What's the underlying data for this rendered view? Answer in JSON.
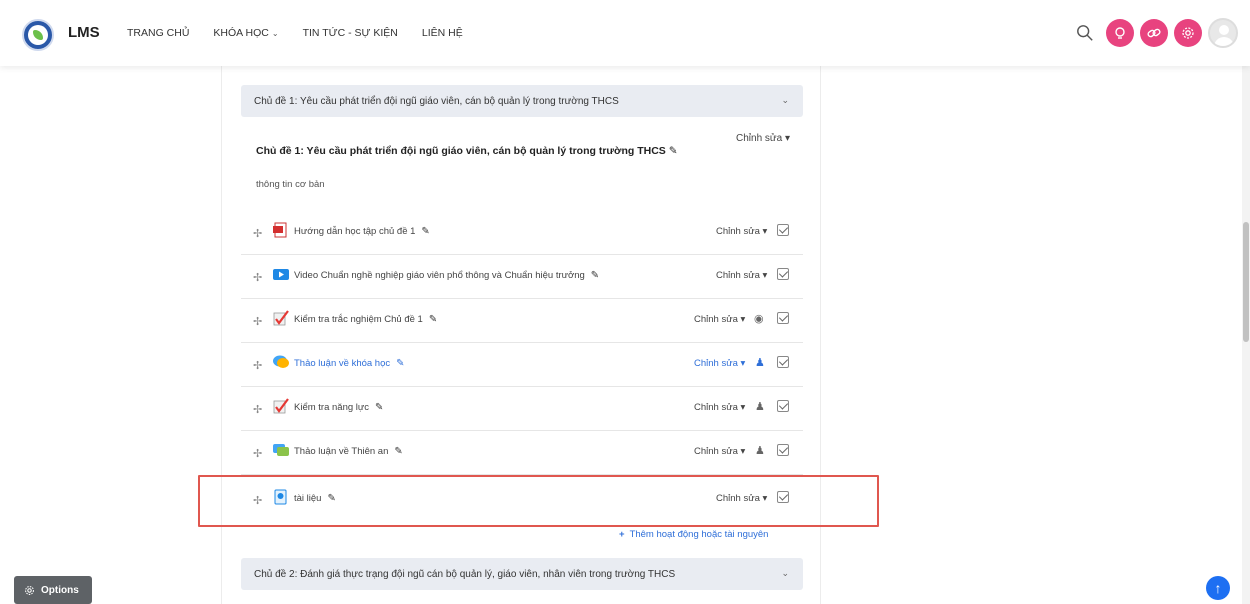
{
  "header": {
    "brand": "LMS",
    "nav": [
      {
        "label": "TRANG CHỦ"
      },
      {
        "label": "KHÓA HỌC",
        "dropdown": true
      },
      {
        "label": "TIN TỨC - SỰ KIỆN"
      },
      {
        "label": "LIÊN HỆ"
      }
    ],
    "icons": [
      "search-icon",
      "lightbulb-icon",
      "link-icon",
      "settings-icon",
      "avatar-icon"
    ],
    "accent_color": "#e8437f"
  },
  "sections": [
    {
      "title": "Chủ đề 1: Yêu cầu phát triển đội ngũ giáo viên, cán bộ quản lý trong trường THCS"
    },
    {
      "title": "Chủ đề 2: Đánh giá thực trạng đội ngũ cán bộ quản lý, giáo viên, nhân viên trong trường THCS"
    }
  ],
  "section1": {
    "title": "Chủ đề 1: Yêu cầu phát triển đội ngũ giáo viên, cán bộ quản lý trong trường THCS",
    "edit_label": "Chỉnh sửa",
    "summary": "thông tin cơ bản",
    "activities": [
      {
        "name": "Hướng dẫn học tập chủ đề 1",
        "icon": "pdf-icon",
        "edit": "Chỉnh sửa",
        "link": false
      },
      {
        "name": "Video Chuẩn nghề nghiệp giáo viên phổ thông và Chuẩn hiệu trưởng",
        "icon": "video-icon",
        "edit": "Chỉnh sửa",
        "link": false
      },
      {
        "name": "Kiểm tra trắc nghiệm Chủ đề 1",
        "icon": "quiz-icon",
        "edit": "Chỉnh sửa",
        "link": false
      },
      {
        "name": "Thảo luận về khóa học",
        "icon": "forum-icon",
        "edit": "Chỉnh sửa",
        "link": true
      },
      {
        "name": "Kiểm tra năng lực",
        "icon": "quiz-icon",
        "edit": "Chỉnh sửa",
        "link": false
      },
      {
        "name": "Thảo luận về Thiên an",
        "icon": "chat-icon",
        "edit": "Chỉnh sửa",
        "link": false
      },
      {
        "name": "tài liệu",
        "icon": "file-icon",
        "edit": "Chỉnh sửa",
        "link": false
      }
    ],
    "add_activity": "Thêm hoạt động hoặc tài nguyên"
  },
  "footer": {
    "options_label": "Options"
  }
}
